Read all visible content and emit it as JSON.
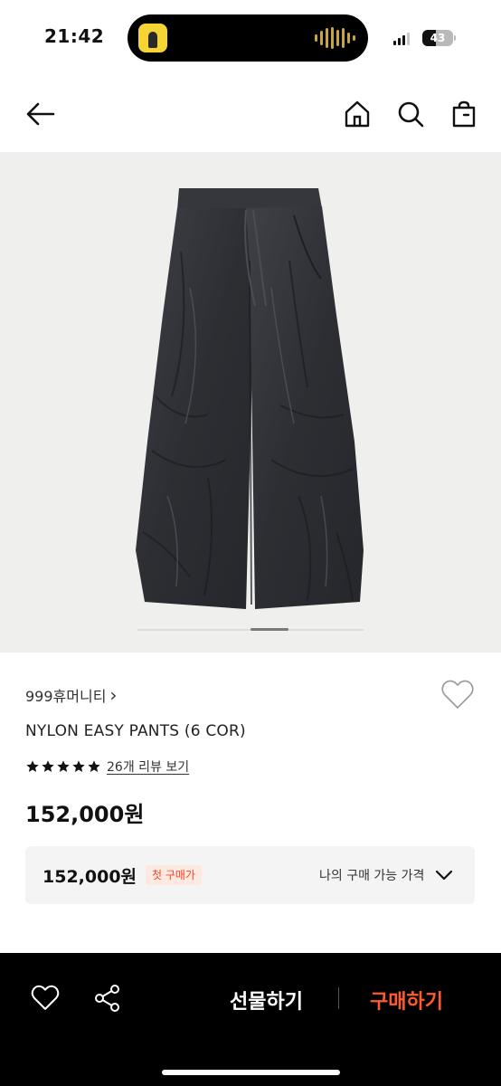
{
  "status_bar": {
    "time": "21:42",
    "battery": "43",
    "battery_level_fraction": 0.43,
    "icons": [
      "music-album-art-icon",
      "audio-waveform-icon",
      "cellular-signal-icon",
      "battery-icon"
    ]
  },
  "nav": {
    "icons": [
      "back-arrow-icon",
      "home-icon",
      "search-icon",
      "shopping-bag-icon"
    ]
  },
  "gallery": {
    "image_subject": "pants-product-image",
    "current_page_fraction": 0.5
  },
  "product": {
    "brand": "999휴머니티",
    "brand_chevron": "›",
    "name": "NYLON EASY PANTS (6 COR)",
    "rating_stars": 5,
    "review_link": "26개 리뷰 보기",
    "price": "152,000원"
  },
  "price_box": {
    "price": "152,000원",
    "badge": "첫 구매가",
    "label": "나의 구매 가능 가격"
  },
  "bottom_bar": {
    "gift_label": "선물하기",
    "buy_label": "구매하기"
  },
  "colors": {
    "accent": "#ff5a2c",
    "badge_bg": "#fde8e2",
    "badge_text": "#ef4a23",
    "bottom_bar_bg": "#000000"
  }
}
